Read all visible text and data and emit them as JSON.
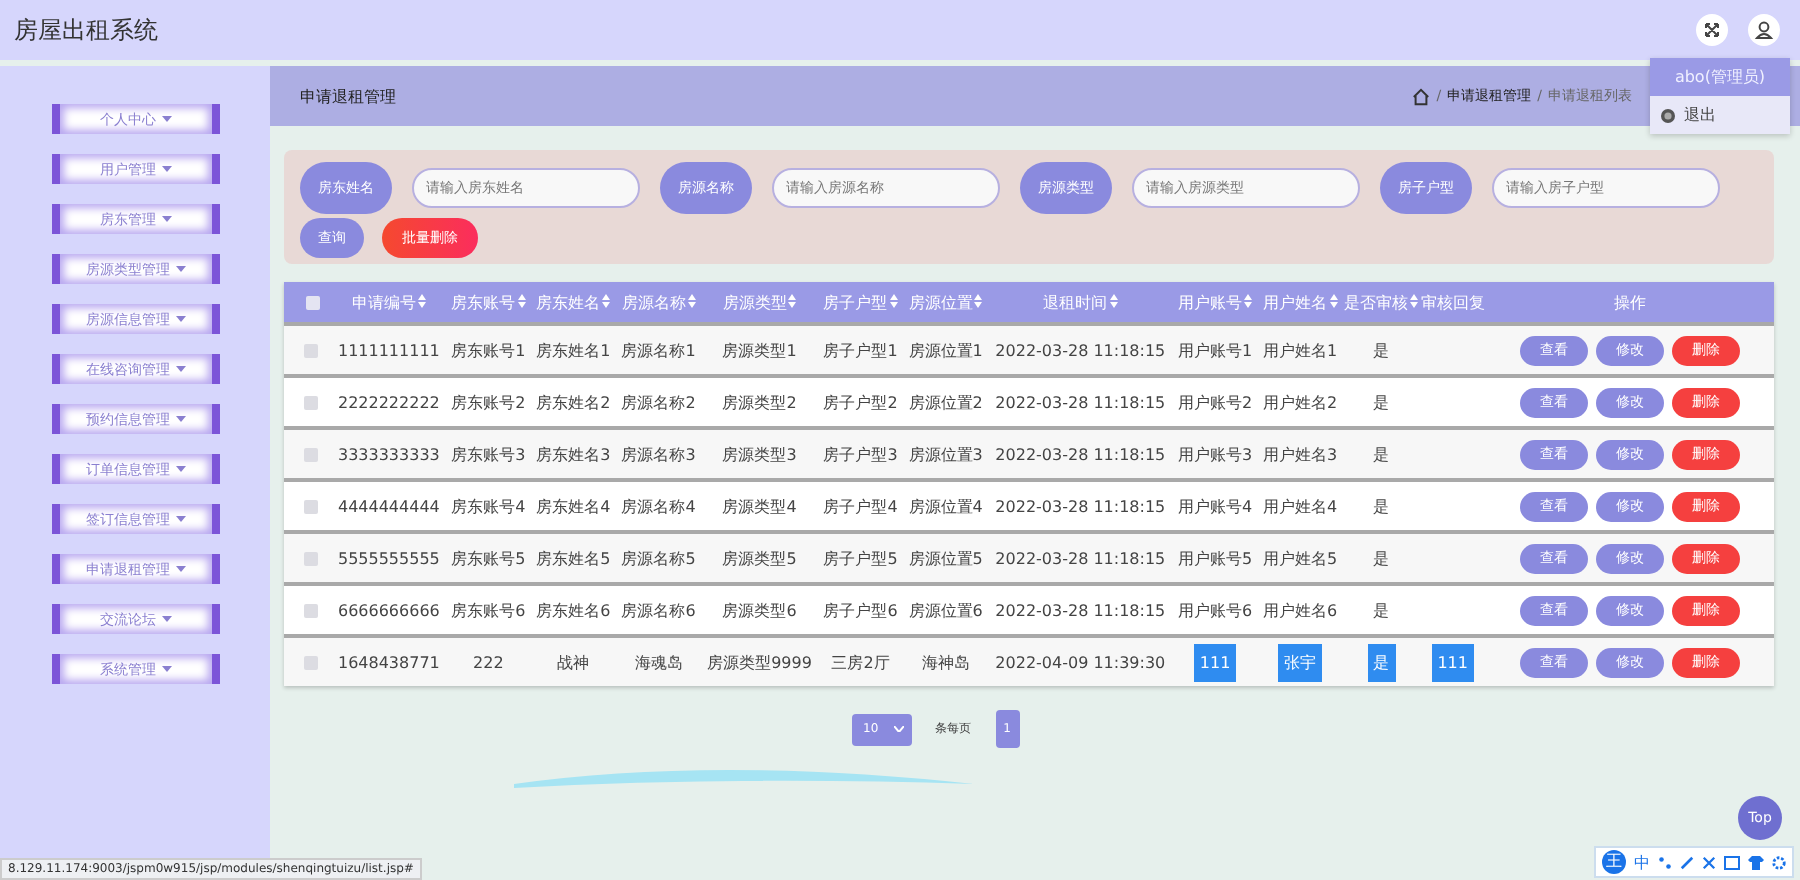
{
  "header": {
    "title": "房屋出租系统"
  },
  "user_menu": {
    "name": "abo(管理员)",
    "items": [
      {
        "label": "退出"
      }
    ]
  },
  "sidebar": {
    "items": [
      {
        "label": "个人中心"
      },
      {
        "label": "用户管理"
      },
      {
        "label": "房东管理"
      },
      {
        "label": "房源类型管理"
      },
      {
        "label": "房源信息管理"
      },
      {
        "label": "在线咨询管理"
      },
      {
        "label": "预约信息管理"
      },
      {
        "label": "订单信息管理"
      },
      {
        "label": "签订信息管理"
      },
      {
        "label": "申请退租管理"
      },
      {
        "label": "交流论坛"
      },
      {
        "label": "系统管理"
      }
    ]
  },
  "page": {
    "title": "申请退租管理",
    "breadcrumb": [
      {
        "separator": "/",
        "label": "申请退租管理"
      },
      {
        "separator": "/",
        "label": "申请退租列表"
      }
    ]
  },
  "search": {
    "fields": [
      {
        "label": "房东姓名",
        "placeholder": "请输入房东姓名"
      },
      {
        "label": "房源名称",
        "placeholder": "请输入房源名称"
      },
      {
        "label": "房源类型",
        "placeholder": "请输入房源类型"
      },
      {
        "label": "房子户型",
        "placeholder": "请输入房子户型"
      }
    ],
    "buttons": [
      {
        "label": "查询",
        "kind": "primary"
      },
      {
        "label": "批量删除",
        "kind": "danger"
      }
    ]
  },
  "table": {
    "all_checked": false,
    "columns": [
      {
        "label": "申请编号",
        "sortable": true
      },
      {
        "label": "房东账号",
        "sortable": true
      },
      {
        "label": "房东姓名",
        "sortable": true
      },
      {
        "label": "房源名称",
        "sortable": true
      },
      {
        "label": "房源类型",
        "sortable": true
      },
      {
        "label": "房子户型",
        "sortable": true
      },
      {
        "label": "房源位置",
        "sortable": true
      },
      {
        "label": "退租时间",
        "sortable": true
      },
      {
        "label": "用户账号",
        "sortable": true
      },
      {
        "label": "用户姓名",
        "sortable": true
      },
      {
        "label": "是否审核",
        "sortable": true
      },
      {
        "label": "审核回复",
        "sortable": false
      },
      {
        "label": "操作",
        "sortable": false
      }
    ],
    "rows": [
      {
        "checked": false,
        "text_selected": false,
        "cells": [
          "1111111111",
          "房东账号1",
          "房东姓名1",
          "房源名称1",
          "房源类型1",
          "房子户型1",
          "房源位置1",
          "2022-03-28 11:18:15",
          "用户账号1",
          "用户姓名1",
          "是"
        ],
        "actions": [
          {
            "label": "查看",
            "kind": "view"
          },
          {
            "label": "修改",
            "kind": "edit"
          },
          {
            "label": "删除",
            "kind": "delete"
          }
        ]
      },
      {
        "checked": false,
        "text_selected": false,
        "cells": [
          "2222222222",
          "房东账号2",
          "房东姓名2",
          "房源名称2",
          "房源类型2",
          "房子户型2",
          "房源位置2",
          "2022-03-28 11:18:15",
          "用户账号2",
          "用户姓名2",
          "是"
        ],
        "actions": [
          {
            "label": "查看",
            "kind": "view"
          },
          {
            "label": "修改",
            "kind": "edit"
          },
          {
            "label": "删除",
            "kind": "delete"
          }
        ]
      },
      {
        "checked": false,
        "text_selected": false,
        "cells": [
          "3333333333",
          "房东账号3",
          "房东姓名3",
          "房源名称3",
          "房源类型3",
          "房子户型3",
          "房源位置3",
          "2022-03-28 11:18:15",
          "用户账号3",
          "用户姓名3",
          "是"
        ],
        "actions": [
          {
            "label": "查看",
            "kind": "view"
          },
          {
            "label": "修改",
            "kind": "edit"
          },
          {
            "label": "删除",
            "kind": "delete"
          }
        ]
      },
      {
        "checked": false,
        "text_selected": false,
        "cells": [
          "4444444444",
          "房东账号4",
          "房东姓名4",
          "房源名称4",
          "房源类型4",
          "房子户型4",
          "房源位置4",
          "2022-03-28 11:18:15",
          "用户账号4",
          "用户姓名4",
          "是"
        ],
        "actions": [
          {
            "label": "查看",
            "kind": "view"
          },
          {
            "label": "修改",
            "kind": "edit"
          },
          {
            "label": "删除",
            "kind": "delete"
          }
        ]
      },
      {
        "checked": false,
        "text_selected": false,
        "cells": [
          "5555555555",
          "房东账号5",
          "房东姓名5",
          "房源名称5",
          "房源类型5",
          "房子户型5",
          "房源位置5",
          "2022-03-28 11:18:15",
          "用户账号5",
          "用户姓名5",
          "是"
        ],
        "actions": [
          {
            "label": "查看",
            "kind": "view"
          },
          {
            "label": "修改",
            "kind": "edit"
          },
          {
            "label": "删除",
            "kind": "delete"
          }
        ]
      },
      {
        "checked": false,
        "text_selected": false,
        "cells": [
          "6666666666",
          "房东账号6",
          "房东姓名6",
          "房源名称6",
          "房源类型6",
          "房子户型6",
          "房源位置6",
          "2022-03-28 11:18:15",
          "用户账号6",
          "用户姓名6",
          "是"
        ],
        "actions": [
          {
            "label": "查看",
            "kind": "view"
          },
          {
            "label": "修改",
            "kind": "edit"
          },
          {
            "label": "删除",
            "kind": "delete"
          }
        ]
      },
      {
        "checked": false,
        "text_selected": true,
        "cells": [
          "1648438771",
          "222",
          "战神",
          "海魂岛",
          "房源类型9999",
          "三房2厅",
          "海神岛",
          "2022-04-09 11:39:30",
          "111",
          "张宇",
          "是",
          "111"
        ],
        "actions": [
          {
            "label": "查看",
            "kind": "view"
          },
          {
            "label": "修改",
            "kind": "edit"
          },
          {
            "label": "删除",
            "kind": "delete"
          }
        ]
      }
    ]
  },
  "pagination": {
    "page_size": "10",
    "suffix": "条每页",
    "pages": [
      {
        "label": "1",
        "selected": true
      }
    ]
  },
  "top_button": {
    "label": "Top"
  },
  "ime_toolbar": {
    "logo": "王",
    "mode": "中"
  },
  "status_bar": {
    "url": "8.129.11.174:9003/jspm0w915/jsp/modules/shenqingtuizu/list.jsp#"
  }
}
